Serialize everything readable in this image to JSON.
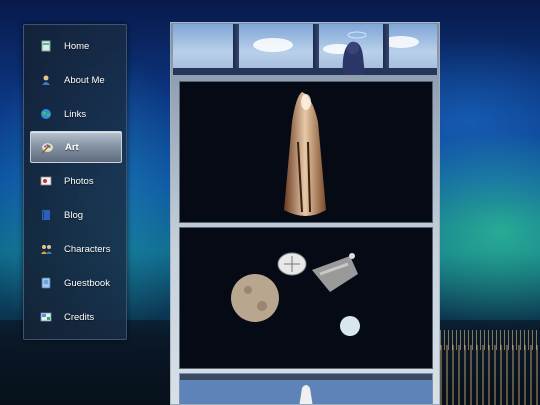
{
  "nav": {
    "items": [
      {
        "label": "Home",
        "icon": "home-icon",
        "active": false
      },
      {
        "label": "About Me",
        "icon": "person-icon",
        "active": false
      },
      {
        "label": "Links",
        "icon": "globe-icon",
        "active": false
      },
      {
        "label": "Art",
        "icon": "palette-icon",
        "active": true
      },
      {
        "label": "Photos",
        "icon": "photo-icon",
        "active": false
      },
      {
        "label": "Blog",
        "icon": "book-icon",
        "active": false
      },
      {
        "label": "Characters",
        "icon": "people-icon",
        "active": false
      },
      {
        "label": "Guestbook",
        "icon": "guestbook-icon",
        "active": false
      },
      {
        "label": "Credits",
        "icon": "credits-icon",
        "active": false
      }
    ]
  },
  "colors": {
    "active_item": "#8795a6",
    "sidebar_bg": "#18283e",
    "panel_bg": "#060a14"
  }
}
